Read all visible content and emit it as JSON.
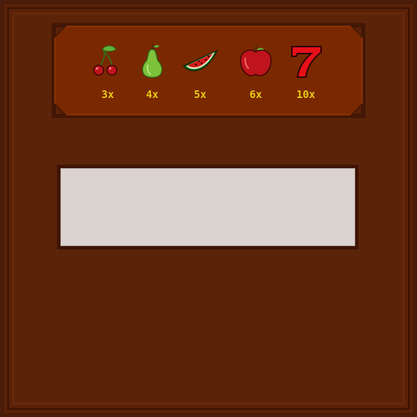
{
  "paytable": {
    "symbols": [
      {
        "name": "cherry-icon",
        "multiplier": "3x"
      },
      {
        "name": "pear-icon",
        "multiplier": "4x"
      },
      {
        "name": "watermelon-icon",
        "multiplier": "5x"
      },
      {
        "name": "apple-icon",
        "multiplier": "6x"
      },
      {
        "name": "seven-icon",
        "multiplier": "10x"
      }
    ]
  },
  "display": {
    "text": ""
  },
  "colors": {
    "board": "#5b2409",
    "paytable_bg": "#7a2800",
    "multiplier_text": "#e6c81a",
    "display_bg": "#dbd3cf"
  }
}
